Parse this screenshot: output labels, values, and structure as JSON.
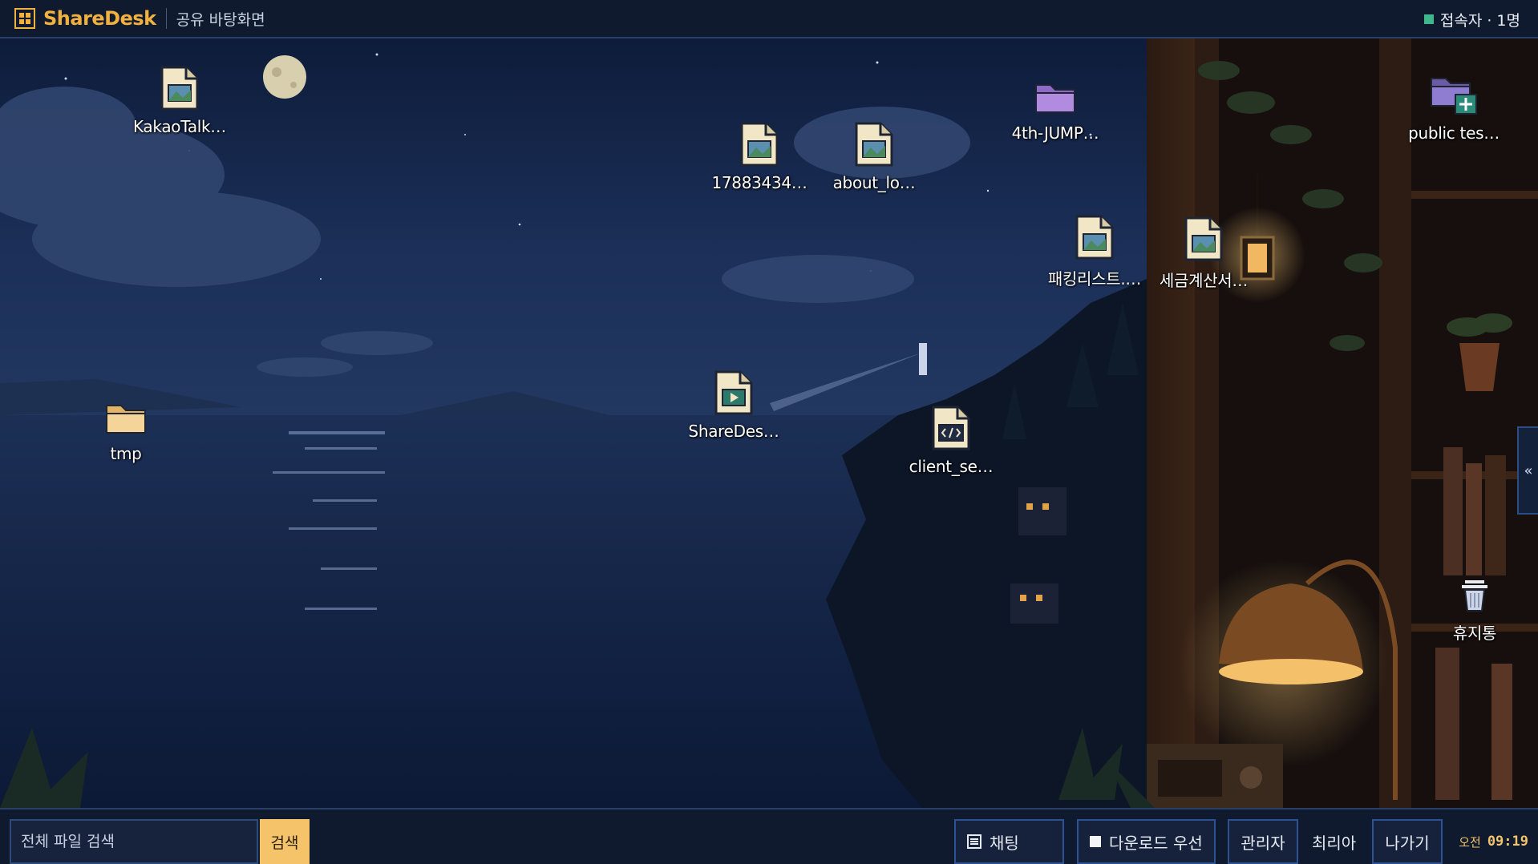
{
  "header": {
    "brand": "ShareDesk",
    "subtitle": "공유 바탕화면",
    "presence": "접속자 · 1명"
  },
  "desktop_items": [
    {
      "label": "KakaoTalk…",
      "icon": "image-file-icon"
    },
    {
      "label": "17883434…",
      "icon": "image-file-icon"
    },
    {
      "label": "about_lo…",
      "icon": "image-file-icon"
    },
    {
      "label": "4th-JUMP…",
      "icon": "folder-icon"
    },
    {
      "label": "public tes…",
      "icon": "shared-folder-icon"
    },
    {
      "label": "패킹리스트.…",
      "icon": "image-file-icon"
    },
    {
      "label": "세금계산서…",
      "icon": "image-file-icon"
    },
    {
      "label": "ShareDes…",
      "icon": "video-file-icon"
    },
    {
      "label": "client_se…",
      "icon": "code-file-icon"
    },
    {
      "label": "tmp",
      "icon": "folder-icon"
    },
    {
      "label": "휴지통",
      "icon": "trash-icon"
    }
  ],
  "side_panel": {
    "toggle": "«"
  },
  "taskbar": {
    "search_placeholder": "전체 파일 검색",
    "search_button": "검색",
    "chat": "채팅",
    "download_priority": "다운로드 우선",
    "admin": "관리자",
    "user": "최리아",
    "leave": "나가기",
    "ampm": "오전",
    "time": "09:19"
  },
  "colors": {
    "accent": "#f2b13e",
    "bar_bg": "#0f1a2e",
    "button_border": "#2d5294",
    "presence_dot": "#3fb68b",
    "search_button": "#f5c46a"
  }
}
